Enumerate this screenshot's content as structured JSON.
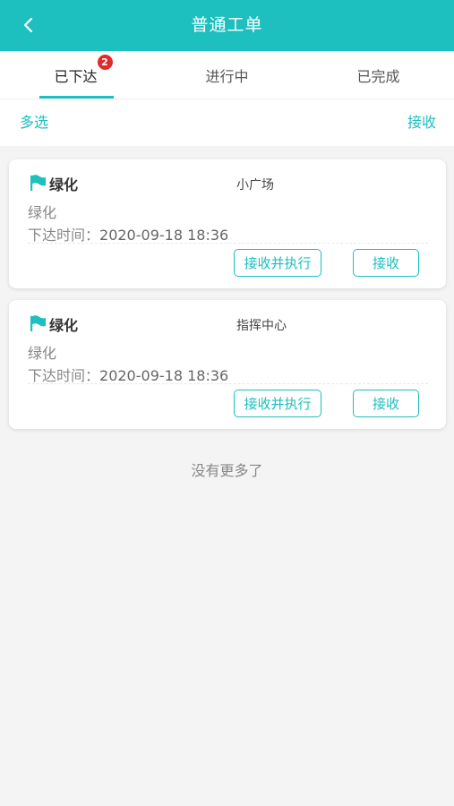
{
  "colors": {
    "accent": "#1dbfbf",
    "badge": "#e02b2b"
  },
  "header": {
    "title": "普通工单",
    "back_icon": "chevron-left-icon"
  },
  "tabs": [
    {
      "label": "已下达",
      "badge": "2",
      "active": true
    },
    {
      "label": "进行中",
      "active": false
    },
    {
      "label": "已完成",
      "active": false
    }
  ],
  "actions": {
    "multi_select": "多选",
    "accept": "接收"
  },
  "orders": [
    {
      "title": "绿化",
      "location": "小广场",
      "category": "绿化",
      "time_label": "下达时间：",
      "time_value": "2020-09-18 18:36",
      "exec_button": "接收并执行",
      "accept_button": "接收"
    },
    {
      "title": "绿化",
      "location": "指挥中心",
      "category": "绿化",
      "time_label": "下达时间：",
      "time_value": "2020-09-18 18:36",
      "exec_button": "接收并执行",
      "accept_button": "接收"
    }
  ],
  "footer": {
    "no_more": "没有更多了"
  }
}
